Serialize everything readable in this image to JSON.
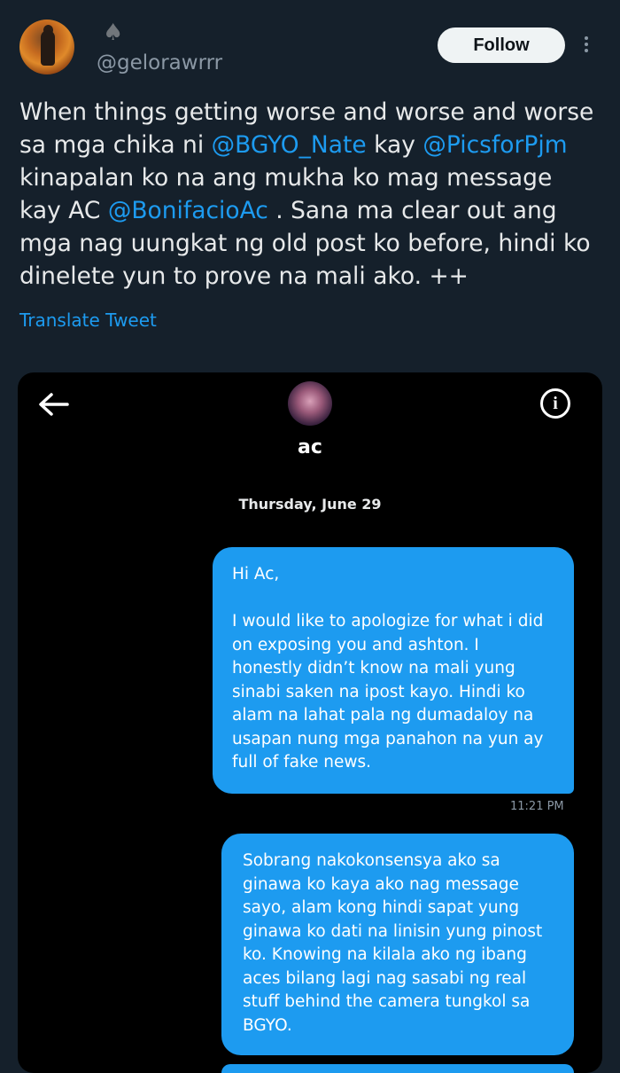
{
  "tweet": {
    "handle": "@gelorawrrr",
    "name_glyph": "♠",
    "follow_label": "Follow",
    "text_parts": [
      {
        "text": "When things getting worse and worse and worse\nsa mga chika ni "
      },
      {
        "text": "@BGYO_Nate",
        "mention": true
      },
      {
        "text": " kay "
      },
      {
        "text": "@PicsforPjm",
        "mention": true
      },
      {
        "text": "\nkinapalan ko na ang mukha ko mag message\nkay AC "
      },
      {
        "text": "@BonifacioAc",
        "mention": true
      },
      {
        "text": " . Sana ma clear out ang\nmga nag uungkat ng old post ko before, hindi ko\ndinelete yun to prove na mali ako. ++"
      }
    ],
    "translate_label": "Translate Tweet"
  },
  "chat": {
    "contact_name": "ac",
    "date": "Thursday, June 29",
    "messages": [
      {
        "text": "Hi Ac,\n\nI would like to apologize for what i did\non exposing you and ashton. I\nhonestly didn’t know na mali yung\nsinabi saken na ipost kayo. Hindi ko\nalam na lahat pala ng dumadaloy na\nusapan nung mga panahon na yun ay\nfull of fake news.",
        "time": "11:21 PM"
      },
      {
        "text": "Sobrang nakokonsensya ako sa\nginawa ko kaya ako nag message\nsayo, alam kong hindi sapat yung\nginawa ko dati na linisin yung pinost\nko. Knowing na kilala ako ng ibang\naces bilang lagi nag sasabi ng real\nstuff behind the camera tungkol sa\nBGYO."
      }
    ]
  },
  "colors": {
    "background": "#15202b",
    "accent": "#1d9bf0",
    "bubble": "#1d9bf0",
    "chat_background": "#000000"
  },
  "icons": [
    "avatar",
    "spade-icon",
    "more-icon",
    "back-arrow-icon",
    "info-icon"
  ]
}
